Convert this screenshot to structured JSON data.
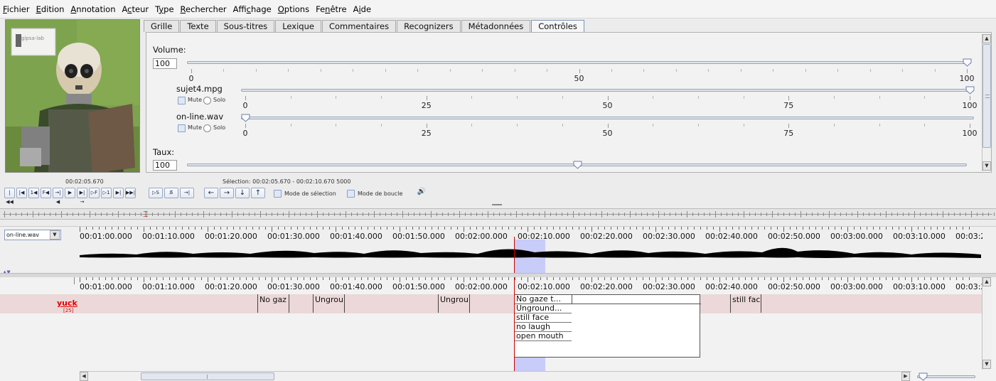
{
  "menu": [
    {
      "label": "Fichier",
      "u": 0
    },
    {
      "label": "Edition",
      "u": 0
    },
    {
      "label": "Annotation",
      "u": 0
    },
    {
      "label": "Acteur",
      "u": 1
    },
    {
      "label": "Type",
      "u": 1
    },
    {
      "label": "Rechercher",
      "u": 0
    },
    {
      "label": "Affichage",
      "u": 4
    },
    {
      "label": "Options",
      "u": 0
    },
    {
      "label": "Fenêtre",
      "u": 2
    },
    {
      "label": "Aide",
      "u": 1
    }
  ],
  "video": {
    "watermark": "gipsa-lab",
    "time": "00:02:05.670"
  },
  "tabs": [
    "Grille",
    "Texte",
    "Sous-titres",
    "Lexique",
    "Commentaires",
    "Recognizers",
    "Métadonnées",
    "Contrôles"
  ],
  "active_tab": 7,
  "controls": {
    "volume": {
      "label": "Volume:",
      "value": "100",
      "level": 100,
      "ticks": [
        "0",
        "50",
        "100"
      ]
    },
    "tracks": [
      {
        "name": "sujet4.mpg",
        "mute": "Mute",
        "solo": "Solo",
        "level": 100,
        "ticks": [
          "0",
          "25",
          "50",
          "75",
          "100"
        ]
      },
      {
        "name": "on-line.wav",
        "mute": "Mute",
        "solo": "Solo",
        "level": 0,
        "ticks": [
          "0",
          "25",
          "50",
          "75",
          "100"
        ]
      }
    ],
    "rate": {
      "label": "Taux:",
      "value": "100",
      "level": 50
    }
  },
  "selection_text": "Sélection: 00:02:05.670 - 00:02:10.670  5000",
  "transport": {
    "mode_selection": "Mode de sélection",
    "mode_boucle": "Mode de boucle",
    "buttons": [
      "|◀◀",
      "|◀",
      "1◀",
      "F◀",
      "→|◀",
      "▶",
      "▶|→",
      "▷F",
      "▷1",
      "▶|",
      "▶▶|"
    ],
    "sel_buttons": [
      "▷S",
      "S̸",
      "→|"
    ],
    "arrows": [
      "←",
      "→",
      "↓",
      "↑"
    ]
  },
  "waveform": {
    "track_selector": "on-line.wav"
  },
  "time_labels": [
    "00:01:00.000",
    "00:01:10.000",
    "00:01:20.000",
    "00:01:30.000",
    "00:01:40.000",
    "00:01:50.000",
    "00:02:00.000",
    "00:02:10.000",
    "00:02:20.000",
    "00:02:30.000",
    "00:02:40.000",
    "00:02:50.000",
    "00:03:00.000",
    "00:03:10.000",
    "00:03:2"
  ],
  "tier": {
    "name": "yuck",
    "count": "[25]"
  },
  "annotations": [
    {
      "text": "No gaz"
    },
    {
      "text": "Ungrou"
    },
    {
      "text": "Ungrou"
    },
    {
      "text": "No gaze t..."
    },
    {
      "text": "still fac"
    }
  ],
  "dropdown_options": [
    "Unground...",
    "still face",
    "no laugh",
    "open mouth"
  ],
  "colors": {
    "accent": "#7e92b8",
    "cursor": "#cc0000",
    "selection": "#c8ccf8",
    "tier_bg": "#ecd8d8",
    "tier_label": "#dd0000"
  }
}
